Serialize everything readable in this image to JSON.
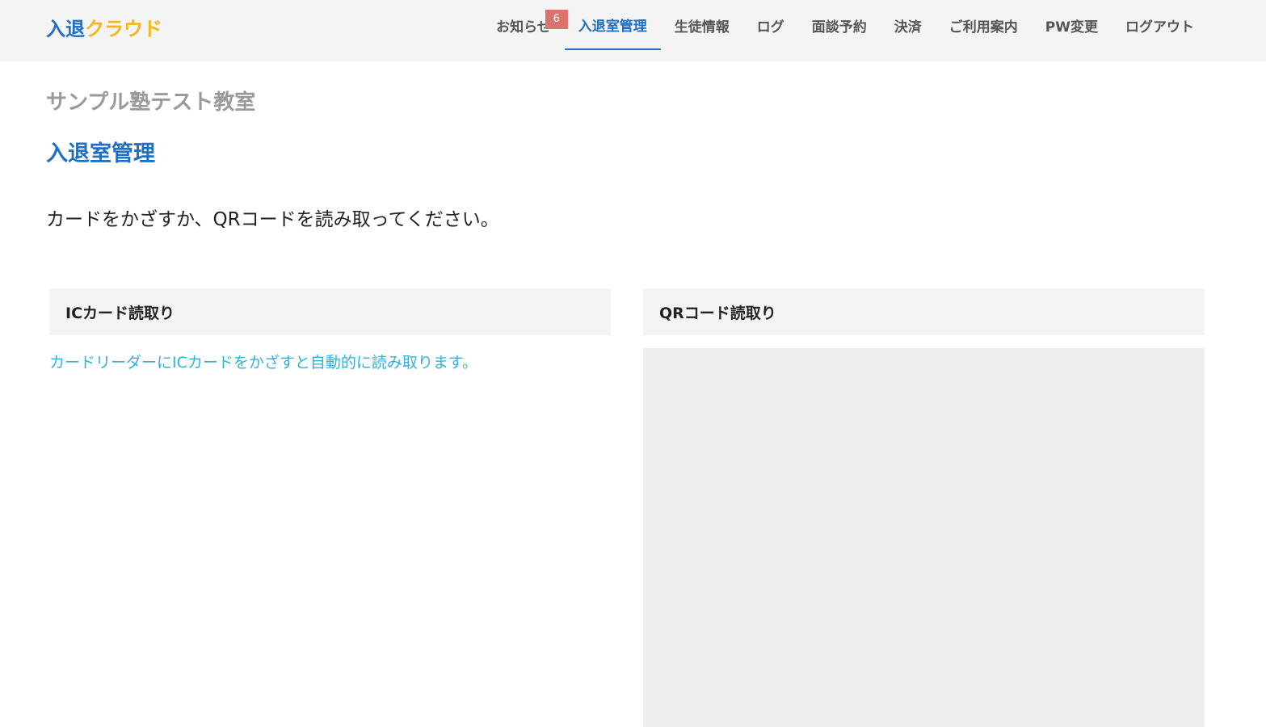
{
  "header": {
    "logo_part1": "入退",
    "logo_part2": "クラウド",
    "nav": [
      {
        "label": "お知らせ",
        "badge": "6"
      },
      {
        "label": "入退室管理",
        "active": true
      },
      {
        "label": "生徒情報"
      },
      {
        "label": "ログ"
      },
      {
        "label": "面談予約"
      },
      {
        "label": "決済"
      },
      {
        "label": "ご利用案内"
      },
      {
        "label": "PW変更"
      },
      {
        "label": "ログアウト"
      }
    ]
  },
  "main": {
    "school_name": "サンプル塾テスト教室",
    "page_title": "入退室管理",
    "instruction": "カードをかざすか、QRコードを読み取ってください。",
    "ic_panel": {
      "title": "ICカード読取り",
      "note": "カードリーダーにICカードをかざすと自動的に読み取ります。"
    },
    "qr_panel": {
      "title": "QRコード読取り"
    }
  },
  "colors": {
    "brand_blue": "#1f6fc6",
    "brand_yellow": "#f3b71b",
    "badge_red": "#d9736b",
    "note_cyan": "#2fb3dc"
  }
}
